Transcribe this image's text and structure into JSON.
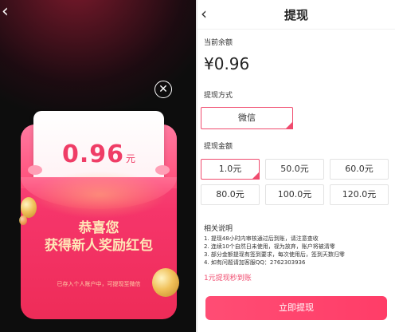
{
  "left_panel": {
    "close_glyph": "✕",
    "back_glyph": "‹",
    "envelope": {
      "amount": "0.96",
      "unit": "元",
      "congrats": "恭喜您",
      "reward": "获得新人奖励红包",
      "deposit_note": "已存入个人账户中，可提现至微信"
    }
  },
  "right_panel": {
    "back_glyph": "‹",
    "title": "提现",
    "balance_label": "当前余额",
    "balance_value": "¥0.96",
    "method_label": "提现方式",
    "method": "微信",
    "amount_label": "提现金额",
    "amounts": [
      "1.0元",
      "50.0元",
      "60.0元",
      "80.0元",
      "100.0元",
      "120.0元"
    ],
    "selected_amount_index": 0,
    "notes_title": "相关说明",
    "notes": [
      "1. 提现48小时内审核通过后到账，请注意查收",
      "2. 连续10个自然日未使用，视为放弃，账户将被清零",
      "3. 部分金额提现有签到要求，每次使用后，签到天数归零",
      "4. 如有问题请加客服QQ：2762303936"
    ],
    "promo": "1元提现秒到账",
    "withdraw_button": "立即提现"
  },
  "colors": {
    "accent": "#f04b6e",
    "envelope": "#f5356a",
    "envelope_text": "#ffe7b8",
    "left_background": "#0d0d0d"
  }
}
